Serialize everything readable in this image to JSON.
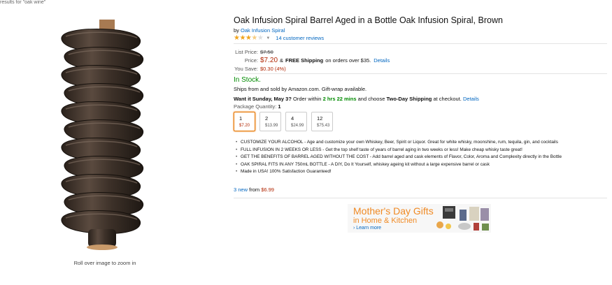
{
  "breadcrumb": "results for \"oak wine\"",
  "image": {
    "alt": "Oak Infusion Spiral",
    "zoom_hint": "Roll over image to zoom in"
  },
  "product": {
    "title": "Oak Infusion Spiral Barrel Aged in a Bottle Oak Infusion Spiral, Brown",
    "by_prefix": "by",
    "brand": "Oak Infusion Spiral",
    "rating": 3.5,
    "reviews_label": "14 customer reviews"
  },
  "pricing": {
    "list_price_label": "List Price:",
    "list_price": "$7.50",
    "price_label": "Price:",
    "price": "$7.20",
    "shipping_amp": "&",
    "free_shipping": "FREE Shipping",
    "shipping_rest": "on orders over $35.",
    "details_link": "Details",
    "save_label": "You Save:",
    "save_value": "$0.30 (4%)"
  },
  "availability": {
    "status": "In Stock.",
    "ships_from": "Ships from and sold by Amazon.com. Gift-wrap available.",
    "want_it": "Want it Sunday, May 3?",
    "order_within": "Order within",
    "countdown": "2 hrs 22 mins",
    "choose_text": "and choose",
    "two_day": "Two-Day Shipping",
    "checkout_text": "at checkout.",
    "details_link": "Details"
  },
  "quantity": {
    "label": "Package Quantity:",
    "selected": "1",
    "options": [
      {
        "qty": "1",
        "price": "$7.20",
        "selected": true
      },
      {
        "qty": "2",
        "price": "$13.99",
        "selected": false
      },
      {
        "qty": "4",
        "price": "$24.99",
        "selected": false
      },
      {
        "qty": "12",
        "price": "$75.43",
        "selected": false
      }
    ]
  },
  "bullets": [
    "CUSTOMIZE YOUR ALCOHOL - Age and customize your own Whiskey, Beer, Spirit or Liquor. Great for white whisky, moonshine, rum, tequila, gin, and cocktails",
    "FULL INFUSION IN 2 WEEKS OR LESS - Get the top shelf taste of years of barrel aging in two weeks or less! Make cheap whisky taste great!",
    "GET THE BENEFITS OF BARREL AGED WITHOUT THE COST - Add barrel aged and cask elements of Flavor, Color, Aroma and Complexity directly in the Bottle",
    "OAK SPIRAL FITS IN ANY 750mL BOTTLE - A DIY, Do It Yourself, whiskey ageing kit without a large expensive barrel or cask",
    "Made in USA! 100% Satisfaction Guaranteed!"
  ],
  "offers": {
    "new_count": "3 new",
    "from_text": "from",
    "from_price": "$6.99"
  },
  "ad": {
    "title": "Mother's Day Gifts",
    "subtitle": "in Home & Kitchen",
    "learn_more": "› Learn more"
  },
  "colors": {
    "link": "#0066c0",
    "price": "#b12704",
    "in_stock": "#008a00",
    "star": "#f0a41c",
    "ad_orange": "#f08a24",
    "selected_border": "#e77600"
  }
}
